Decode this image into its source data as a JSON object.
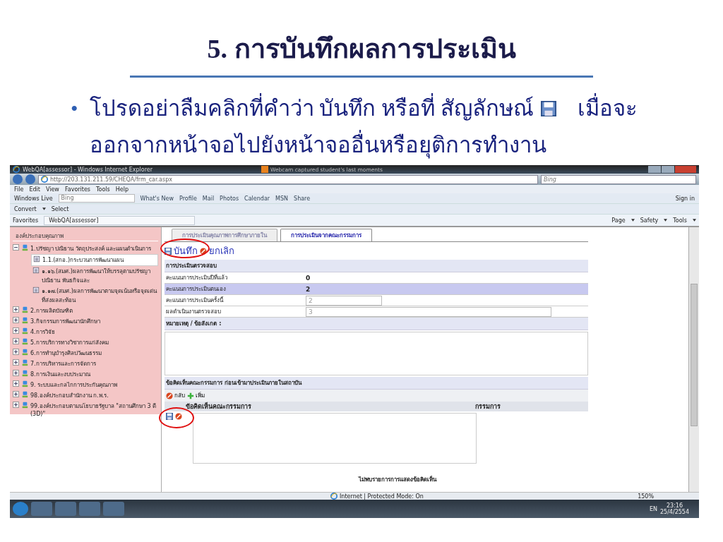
{
  "slide": {
    "title": "5. การบันทึกผลการประเมิน",
    "bullet": {
      "symbol": "•",
      "text_before_icon": "โปรดอย่าลืมคลิกที่คำว่า บันทึก หรือที่ สัญลักษณ์",
      "text_after_icon": "เมื่อจะ",
      "continuation": "ออกจากหน้าจอไปยังหน้าจออื่นหรือยุติการทำงาน"
    }
  },
  "browser": {
    "title": "WebQA[assessor] - Windows Internet Explorer",
    "notification": "Webcam captured student's last moments",
    "address": "http://203.131.211.59/CHEQA/frm_car.aspx",
    "search_placeholder": "Bing",
    "menu": [
      "File",
      "Edit",
      "View",
      "Favorites",
      "Tools",
      "Help"
    ],
    "links_toolbar": {
      "brand": "Windows Live",
      "search_placeholder": "Bing",
      "links": [
        "What's New",
        "Profile",
        "Mail",
        "Photos",
        "Calendar",
        "MSN",
        "Share"
      ],
      "sign_in": "Sign in"
    },
    "addon_toolbar": [
      "Convert",
      "Select"
    ],
    "favorites": {
      "label": "Favorites",
      "tab": "WebQA[assessor]"
    },
    "command_bar": [
      "Page",
      "Safety",
      "Tools"
    ],
    "status": {
      "zone": "Internet | Protected Mode: On",
      "zoom": "150%"
    }
  },
  "sidebar": {
    "header": "องค์ประกอบคุณภาพ",
    "tree": [
      {
        "label": "1.ปรัชญา ปณิธาน วัตถุประสงค์ และแผนดำเนินการ",
        "expanded": true,
        "children": [
          {
            "label": "1.1.(สกอ.)กระบวนการพัฒนาแผน",
            "selected": true
          },
          {
            "label": "๑.๑๖.(สมศ.)ผลการพัฒนาให้บรรลุตามปรัชญา ปณิธาน พันธกิจและ",
            "selected": false
          },
          {
            "label": "๑.๑๗.(สมศ.)ผลการพัฒนาตามจุดเน้นหรือจุดเด่นที่ส่งผลสะท้อน",
            "selected": false
          }
        ]
      },
      {
        "label": "2.การผลิตบัณฑิต",
        "expanded": false
      },
      {
        "label": "3.กิจกรรมการพัฒนานักศึกษา",
        "expanded": false
      },
      {
        "label": "4.การวิจัย",
        "expanded": false
      },
      {
        "label": "5.การบริการทางวิชาการแก่สังคม",
        "expanded": false
      },
      {
        "label": "6.การทำนุบำรุงศิลปวัฒนธรรม",
        "expanded": false
      },
      {
        "label": "7.การบริหารและการจัดการ",
        "expanded": false
      },
      {
        "label": "8.การเงินและงบประมาณ",
        "expanded": false
      },
      {
        "label": "9. ระบบและกลไกการประกันคุณภาพ",
        "expanded": false
      },
      {
        "label": "98.องค์ประกอบสำนักงาน ก.พ.ร.",
        "expanded": false
      },
      {
        "label": "99.องค์ประกอบตามนโยบายรัฐบาล \"สถานศึกษา 3 ดี (3D)\"",
        "expanded": false
      }
    ]
  },
  "main": {
    "tabs": [
      {
        "label": "การประเมินคุณภาพการศึกษาภายใน",
        "selected": false
      },
      {
        "label": "การประเมินจากคณะกรรมการ",
        "selected": true
      }
    ],
    "actions": [
      {
        "label": "บันทึก",
        "kind": "save"
      },
      {
        "label": "ยกเลิก",
        "kind": "cancel"
      }
    ],
    "section_title": "การประเมินตรวจสอบ",
    "rows": [
      {
        "label": "คะแนนการประเมินปีที่แล้ว",
        "value": "0",
        "kind": "text",
        "highlighted": false
      },
      {
        "label": "คะแนนการประเมินตนเอง",
        "value": "2",
        "kind": "text",
        "highlighted": true
      },
      {
        "label": "คะแนนการประเมินครั้งนี้",
        "value": "2",
        "kind": "short_field",
        "highlighted": false
      },
      {
        "label": "ผลดำเนินงานตรวจสอบ",
        "value": "3",
        "kind": "long_field",
        "highlighted": false
      }
    ],
    "remarks_label": "หมายเหตุ / ข้อสังเกต :",
    "committee": {
      "title": "ข้อคิดเห็นคณะกรรมการ ก่อนเข้ามาประเมินภายในสถาบัน",
      "actions": [
        {
          "label": "กลับ",
          "kind": "back"
        },
        {
          "label": "เพิ่ม",
          "kind": "add"
        }
      ],
      "columns": [
        "ข้อคิดเห็นคณะกรรมการ",
        "กรรมการ"
      ],
      "empty_message": "ไม่พบรายการการแสดงข้อคิดเห็น"
    }
  },
  "taskbar": {
    "language": "EN",
    "time": "23:16",
    "date": "25/4/2554"
  }
}
